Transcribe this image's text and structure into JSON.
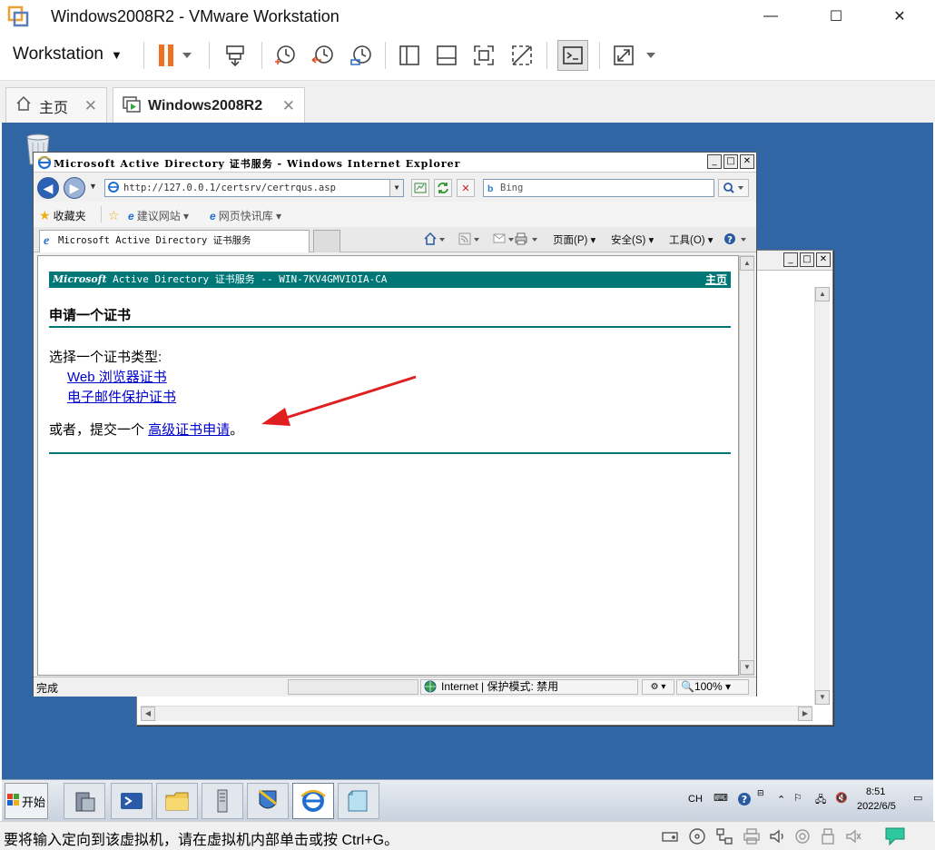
{
  "vmware": {
    "window_title": "Windows2008R2 - VMware Workstation",
    "menu_label": "Workstation",
    "tabs": [
      {
        "label": "主页"
      },
      {
        "label": "Windows2008R2"
      }
    ],
    "status_text": "要将输入定向到该虚拟机，请在虚拟机内部单击或按 Ctrl+G。"
  },
  "ie": {
    "window_title": "Microsoft Active Directory 证书服务 - Windows Internet Explorer",
    "address": "http://127.0.0.1/certsrv/certrqus.asp",
    "search_placeholder": "Bing",
    "favorites_label": "收藏夹",
    "fav_items": [
      "建议网站 ▾",
      "网页快讯库 ▾"
    ],
    "tab_title": "Microsoft Active Directory 证书服务",
    "commands": {
      "page": "页面(P) ▾",
      "safety": "安全(S) ▾",
      "tools": "工具(O) ▾"
    },
    "status": {
      "done": "完成",
      "zone": "Internet | 保护模式: 禁用",
      "zoom": "100%"
    }
  },
  "page": {
    "banner_ms": "Microsoft",
    "banner_rest": " Active Directory 证书服务  --  WIN-7KV4GMVIOIA-CA",
    "home_link": "主页",
    "heading": "申请一个证书",
    "select_prompt": "选择一个证书类型:",
    "links": [
      "Web 浏览器证书",
      "电子邮件保护证书"
    ],
    "or_prefix": "或者，提交一个 ",
    "advanced_link": "高级证书申请",
    "or_suffix": "。"
  },
  "taskbar": {
    "start_label": "开始",
    "lang": "CH",
    "time": "8:51",
    "date": "2022/6/5"
  },
  "colors": {
    "desktop": "#2f66a3",
    "banner": "#007777",
    "link": "#0000cc",
    "annotation_arrow": "#e02020"
  }
}
